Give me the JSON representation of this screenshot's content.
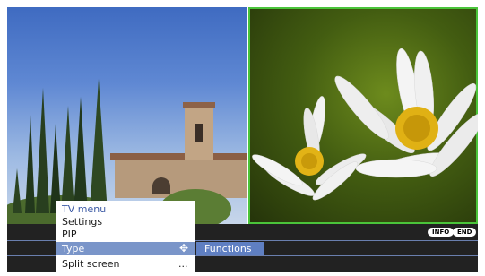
{
  "menu": {
    "title": "TV menu",
    "items": [
      {
        "label": "Settings"
      },
      {
        "label": "PIP"
      },
      {
        "label": "Type",
        "selected": true,
        "icon": "move-arrows-icon"
      },
      {
        "label": "Split screen",
        "trailing": "..."
      }
    ]
  },
  "submenu": {
    "label": "Functions"
  },
  "buttons": {
    "info": "INFO",
    "end": "END"
  },
  "colors": {
    "highlight": "#7a95c9",
    "submenu": "#5f7fc2",
    "title": "#3c5aa5",
    "band": "#222222",
    "focus_border": "#4ac43a"
  }
}
